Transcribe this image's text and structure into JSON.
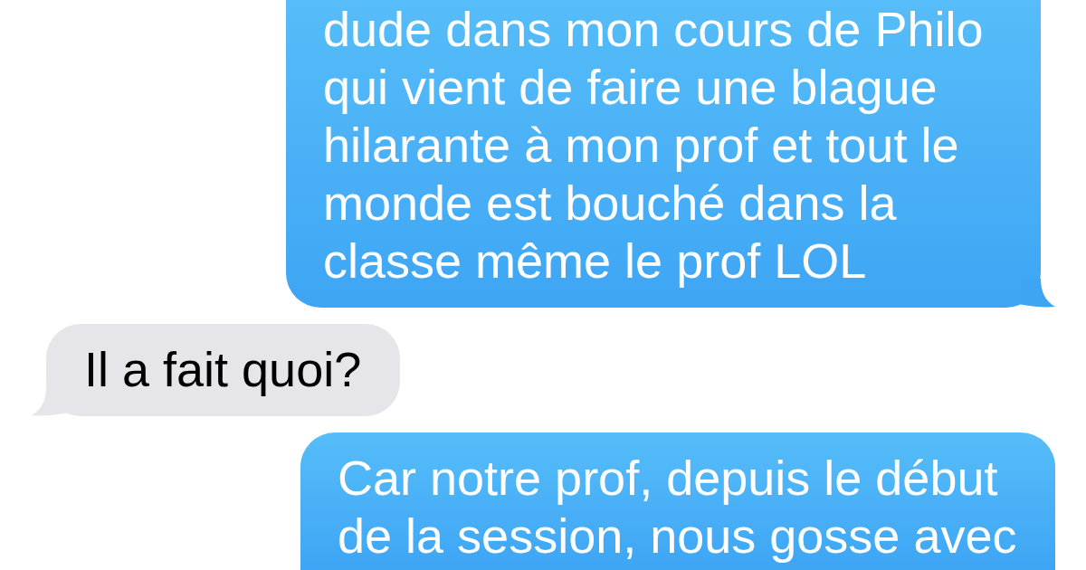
{
  "messages": [
    {
      "kind": "sent",
      "text": "dude dans mon cours de Philo qui vient de faire une blague hilarante à mon prof et tout le monde est bouché dans la classe même le prof LOL",
      "tail": true
    },
    {
      "kind": "received",
      "text": "Il a fait quoi?",
      "tail": true
    },
    {
      "kind": "sent",
      "text": "Car notre prof, depuis le début de la session, nous gosse avec",
      "tail": false
    }
  ]
}
